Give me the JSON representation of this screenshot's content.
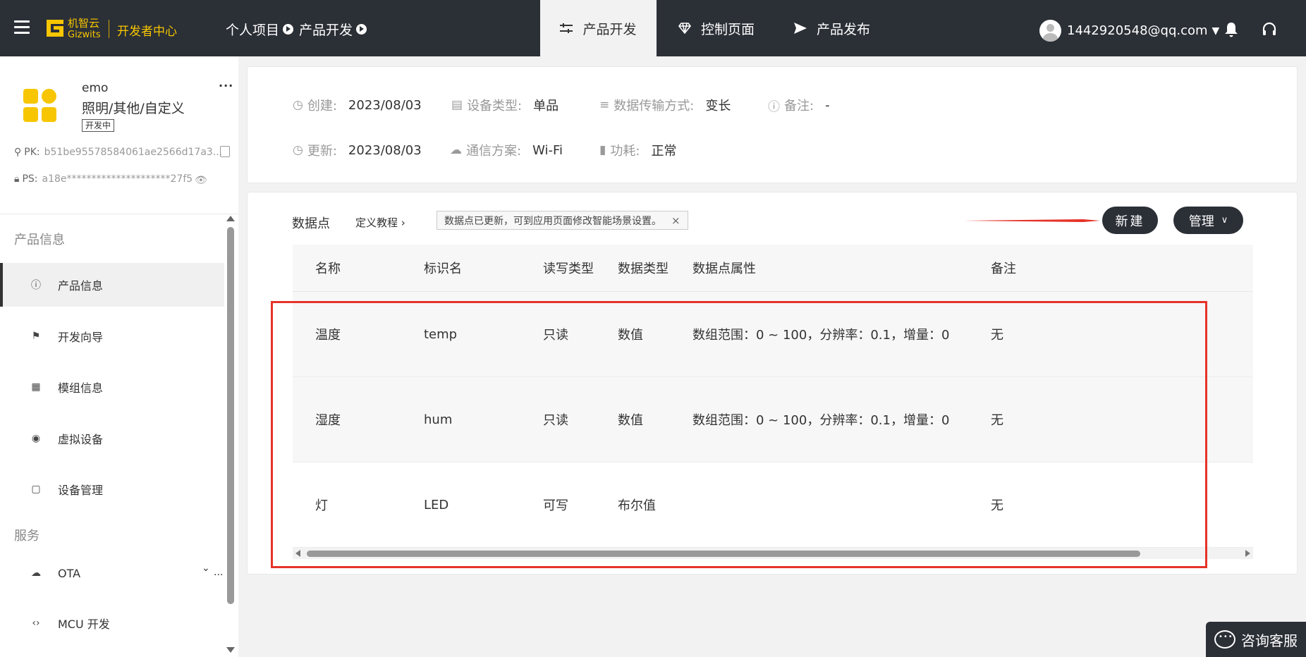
{
  "header": {
    "brand_cn": "机智云",
    "brand_en": "Gizwits",
    "brand_center": "开发者中心",
    "breadcrumbs": [
      "个人项目",
      "产品开发"
    ],
    "tabs": [
      {
        "label": "产品开发",
        "icon": "sliders-icon",
        "active": true
      },
      {
        "label": "控制页面",
        "icon": "diamond-icon",
        "active": false
      },
      {
        "label": "产品发布",
        "icon": "send-icon",
        "active": false
      }
    ],
    "user_email": "1442920548@qq.com"
  },
  "product": {
    "name": "emo",
    "category": "照明/其他/自定义",
    "status": "开发中",
    "more": "...",
    "pk_label": "PK:",
    "pk_value": "b51be95578584061ae2566d17a3...",
    "ps_label": "PS:",
    "ps_value": "a18e*********************27f5"
  },
  "sidebar": {
    "section_info": "产品信息",
    "section_service": "服务",
    "items": [
      {
        "label": "产品信息",
        "icon": "info-icon",
        "active": true
      },
      {
        "label": "开发向导",
        "icon": "signpost-icon",
        "active": false
      },
      {
        "label": "模组信息",
        "icon": "grid-icon",
        "active": false
      },
      {
        "label": "虚拟设备",
        "icon": "virtual-device-icon",
        "active": false
      },
      {
        "label": "设备管理",
        "icon": "clipboard-icon",
        "active": false
      },
      {
        "label": "OTA",
        "icon": "cloud-upload-icon",
        "active": false
      },
      {
        "label": "MCU 开发",
        "icon": "code-icon",
        "active": false
      }
    ]
  },
  "info": {
    "created_label": "创建:",
    "created_value": "2023/08/03",
    "device_type_label": "设备类型:",
    "device_type_value": "单品",
    "transfer_label": "数据传输方式:",
    "transfer_value": "变长",
    "note_label": "备注:",
    "note_value": "-",
    "updated_label": "更新:",
    "updated_value": "2023/08/03",
    "comm_label": "通信方案:",
    "comm_value": "Wi-Fi",
    "power_label": "功耗:",
    "power_value": "正常"
  },
  "datapoints": {
    "title": "数据点",
    "tutorial": "定义教程",
    "notice": "数据点已更新，可到应用页面修改智能场景设置。",
    "new_button": "新建",
    "manage_button": "管理",
    "columns": [
      "名称",
      "标识名",
      "读写类型",
      "数据类型",
      "数据点属性",
      "备注"
    ],
    "rows": [
      [
        "温度",
        "temp",
        "只读",
        "数值",
        "数组范围：0 ~ 100，分辨率：0.1，增量：0",
        "无"
      ],
      [
        "湿度",
        "hum",
        "只读",
        "数值",
        "数组范围：0 ~ 100，分辨率：0.1，增量：0",
        "无"
      ],
      [
        "灯",
        "LED",
        "可写",
        "布尔值",
        "",
        "无"
      ]
    ]
  },
  "support": {
    "consult_label": "咨询客服"
  },
  "colors": {
    "topbar": "#2b2f36",
    "brand": "#f7c600",
    "highlight": "#e53329"
  }
}
